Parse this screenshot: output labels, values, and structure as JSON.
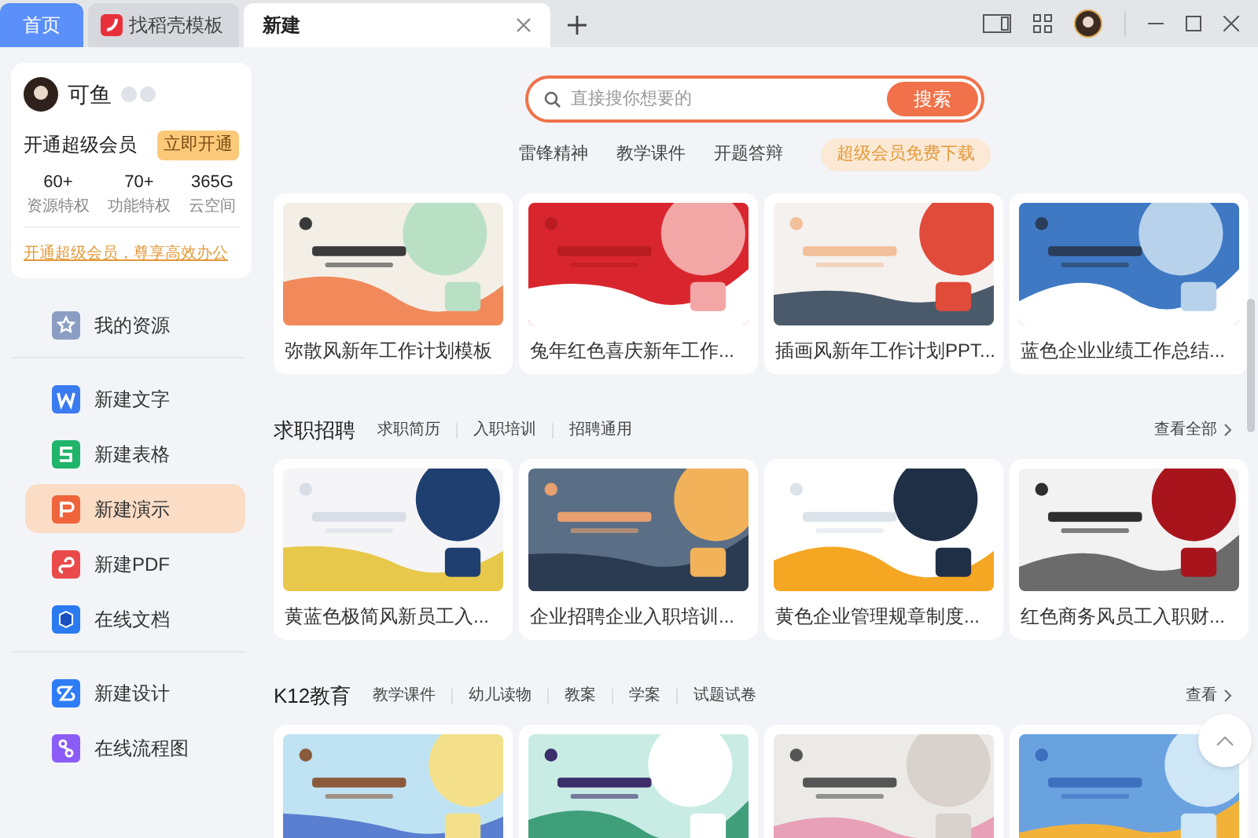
{
  "tabs": [
    {
      "label": "首页",
      "kind": "home",
      "selected": false
    },
    {
      "label": "找稻壳模板",
      "kind": "docer",
      "selected": false
    },
    {
      "label": "新建",
      "kind": "doc",
      "selected": true
    }
  ],
  "profile": {
    "name": "可鱼",
    "vip_title": "开通超级会员",
    "vip_button": "立即开通",
    "stats": [
      {
        "value": "60+",
        "label": "资源特权"
      },
      {
        "value": "70+",
        "label": "功能特权"
      },
      {
        "value": "365G",
        "label": "云空间"
      }
    ],
    "promo_link": "开通超级会员，尊享高效办公"
  },
  "sidebar": {
    "groups": [
      [
        {
          "label": "我的资源",
          "kind": "resource",
          "selected": false
        }
      ],
      [
        {
          "label": "新建文字",
          "kind": "writer",
          "selected": false
        },
        {
          "label": "新建表格",
          "kind": "sheet",
          "selected": false
        },
        {
          "label": "新建演示",
          "kind": "slides",
          "selected": true
        },
        {
          "label": "新建PDF",
          "kind": "pdf",
          "selected": false
        },
        {
          "label": "在线文档",
          "kind": "online",
          "selected": false
        }
      ],
      [
        {
          "label": "新建设计",
          "kind": "design",
          "selected": false
        },
        {
          "label": "在线流程图",
          "kind": "flow",
          "selected": false
        }
      ]
    ]
  },
  "search": {
    "placeholder": "直接搜你想要的",
    "button": "搜索",
    "hot_tags": [
      "雷锋精神",
      "教学课件",
      "开题答辩"
    ],
    "promo_tag": "超级会员免费下载"
  },
  "sections": [
    {
      "cards": [
        {
          "kind": "picture",
          "title": "弥散风新年工作计划模板"
        },
        {
          "kind": "picture",
          "title": "兔年红色喜庆新年工作..."
        },
        {
          "kind": "picture",
          "title": "插画风新年工作计划PPT..."
        },
        {
          "kind": "picture",
          "title": "蓝色企业业绩工作总结..."
        }
      ]
    },
    {
      "title": "求职招聘",
      "filters": [
        "求职简历",
        "入职培训",
        "招聘通用"
      ],
      "view_all": "查看全部",
      "cards": [
        {
          "kind": "picture",
          "title": "黄蓝色极简风新员工入..."
        },
        {
          "kind": "picture",
          "title": "企业招聘企业入职培训..."
        },
        {
          "kind": "picture",
          "title": "黄色企业管理规章制度..."
        },
        {
          "kind": "picture",
          "title": "红色商务风员工入职财..."
        }
      ]
    },
    {
      "title": "K12教育",
      "filters": [
        "教学课件",
        "幼儿读物",
        "教案",
        "学案",
        "试题试卷"
      ],
      "view_all": "查看"
    }
  ]
}
